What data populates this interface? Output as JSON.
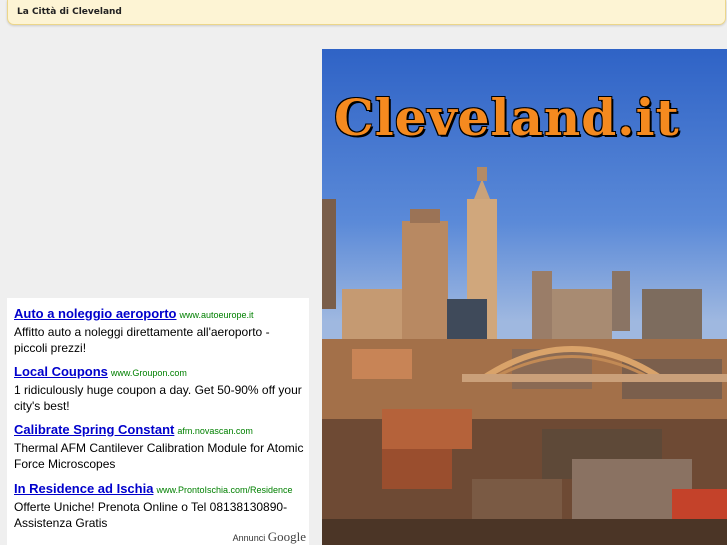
{
  "header": {
    "title": "La Città di Cleveland"
  },
  "ads": [
    {
      "title": "Auto a noleggio aeroporto",
      "url": "www.autoeurope.it",
      "desc": "Affitto auto a noleggi direttamente all'aeroporto - piccoli prezzi!"
    },
    {
      "title": "Local Coupons",
      "url": "www.Groupon.com",
      "desc": "1 ridiculously huge coupon a day. Get 50-90% off your city's best!"
    },
    {
      "title": "Calibrate Spring Constant",
      "url": "afm.novascan.com",
      "desc": "Thermal AFM Cantilever Calibration Module for Atomic Force Microscopes"
    },
    {
      "title": "In Residence ad Ischia",
      "url": "www.ProntoIschia.com/Residence",
      "desc": "Offerte Uniche! Prenota Online o Tel 08138130890-Assistenza Gratis"
    }
  ],
  "ads_footer": {
    "label": "Annunci",
    "brand": "Google"
  },
  "logo": {
    "text": "Cleveland.it"
  },
  "colors": {
    "accent": "#f58a1f",
    "link": "#0000cc",
    "url": "#008000",
    "header_bg": "#fdf4d4"
  }
}
